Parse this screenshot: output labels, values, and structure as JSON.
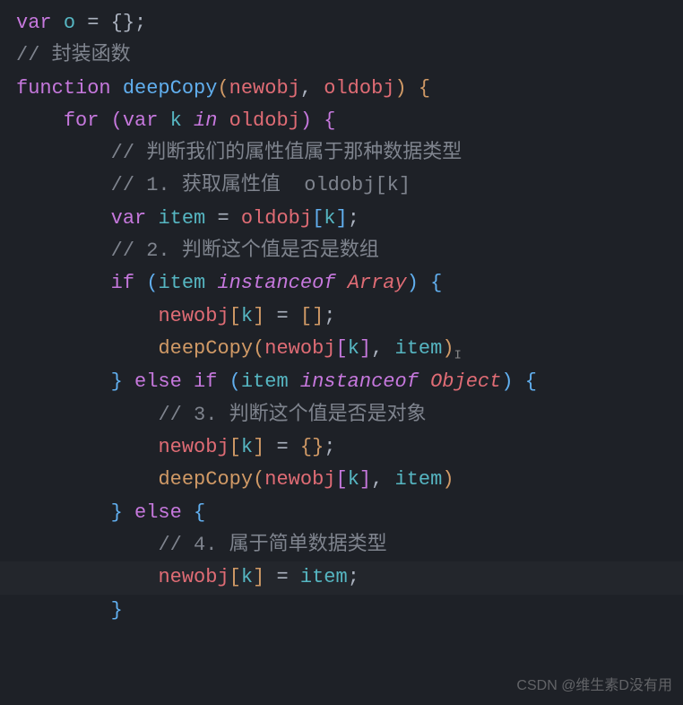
{
  "code": {
    "line1": {
      "var": "var",
      "name": "o",
      "eq": " = ",
      "val": "{};"
    },
    "line2": {
      "comment": "// 封装函数"
    },
    "line3": {
      "kw": "function",
      "fn": "deepCopy",
      "open": "(",
      "p1": "newobj",
      "comma": ", ",
      "p2": "oldobj",
      "close": ") {"
    },
    "line4": {
      "for": "for",
      "open": " (",
      "var": "var",
      "k": "k",
      "in": "in",
      "obj": "oldobj",
      "close": ") {"
    },
    "line5": {
      "comment": "// 判断我们的属性值属于那种数据类型"
    },
    "line6": {
      "comment": "// 1. 获取属性值  oldobj[k]"
    },
    "line7": {
      "var": "var",
      "item": "item",
      "eq": " = ",
      "obj": "oldobj",
      "ob": "[",
      "k": "k",
      "cb": "]",
      "semi": ";"
    },
    "line8": {
      "comment": "// 2. 判断这个值是否是数组"
    },
    "line9": {
      "if": "if",
      "open": " (",
      "item": "item",
      "inst": "instanceof",
      "arr": "Array",
      "close": ") {"
    },
    "line10": {
      "obj": "newobj",
      "ob": "[",
      "k": "k",
      "cb": "]",
      "eq": " = ",
      "val": "[]",
      "semi": ";"
    },
    "line11": {
      "fn": "deepCopy",
      "open": "(",
      "obj": "newobj",
      "ob": "[",
      "k": "k",
      "cb": "]",
      "comma": ", ",
      "item": "item",
      "close": ")"
    },
    "line12": {
      "close": "}",
      "else": "else if",
      "open": " (",
      "item": "item",
      "inst": "instanceof",
      "obj2": "Object",
      "close2": ") {"
    },
    "line13": {
      "comment": "// 3. 判断这个值是否是对象"
    },
    "line14": {
      "obj": "newobj",
      "ob": "[",
      "k": "k",
      "cb": "]",
      "eq": " = ",
      "val": "{}",
      "semi": ";"
    },
    "line15": {
      "fn": "deepCopy",
      "open": "(",
      "obj": "newobj",
      "ob": "[",
      "k": "k",
      "cb": "]",
      "comma": ", ",
      "item": "item",
      "close": ")"
    },
    "line16": {
      "close": "}",
      "else": "else",
      "open": " {"
    },
    "line17": {
      "comment": "// 4. 属于简单数据类型"
    },
    "line18": {
      "obj": "newobj",
      "ob": "[",
      "k": "k",
      "cb": "]",
      "eq": " = ",
      "item": "item",
      "semi": ";"
    },
    "line19": {
      "close": "}"
    }
  },
  "watermark": "CSDN @维生素D没有用"
}
